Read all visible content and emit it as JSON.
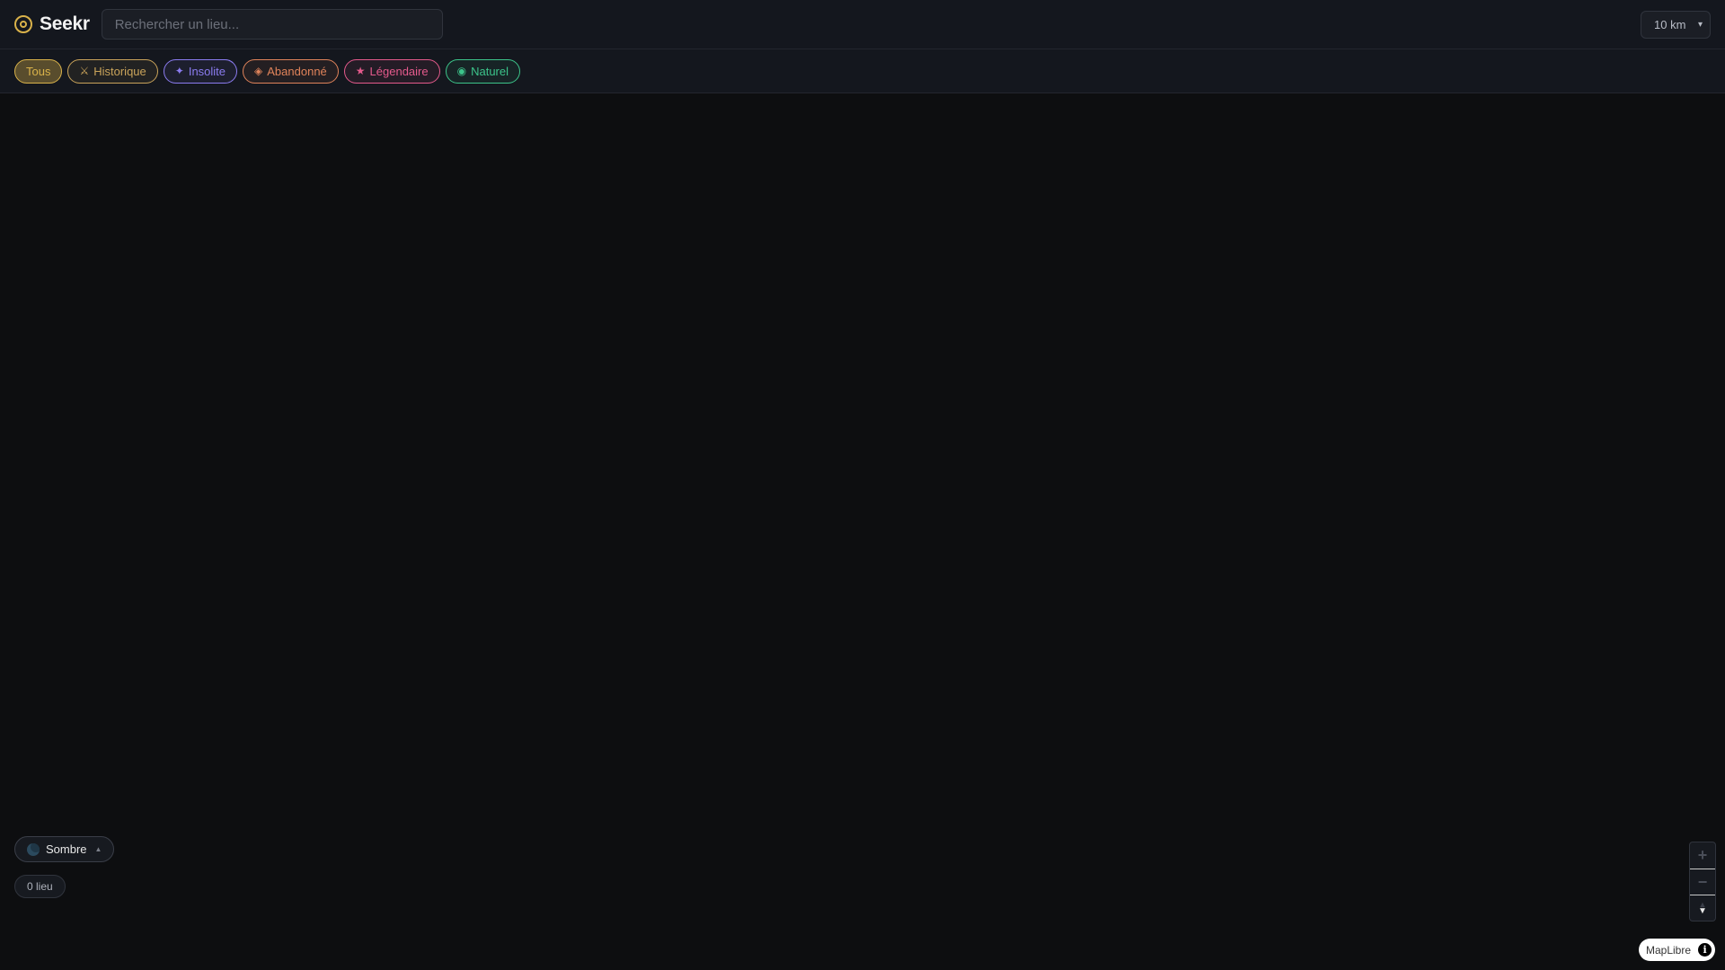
{
  "app": {
    "name": "Seekr",
    "logo_icon": "target-icon",
    "accent": "#d9b24a"
  },
  "search": {
    "placeholder": "Rechercher un lieu...",
    "value": ""
  },
  "radius": {
    "selected": "10 km"
  },
  "filters": [
    {
      "label": "Tous",
      "icon": "",
      "color": "#d9b24a",
      "active": true
    },
    {
      "label": "Historique",
      "icon": "⚔",
      "color": "#c9a35a",
      "active": false
    },
    {
      "label": "Insolite",
      "icon": "✦",
      "color": "#8b7cf0",
      "active": false
    },
    {
      "label": "Abandonné",
      "icon": "◈",
      "color": "#e0835a",
      "active": false
    },
    {
      "label": "Légendaire",
      "icon": "★",
      "color": "#e45a8c",
      "active": false
    },
    {
      "label": "Naturel",
      "icon": "◉",
      "color": "#3cc48a",
      "active": false
    }
  ],
  "map_style": {
    "label": "Sombre",
    "icon": "moon-icon"
  },
  "results": {
    "count_label": "0 lieu"
  },
  "attribution": {
    "label": "MapLibre"
  }
}
